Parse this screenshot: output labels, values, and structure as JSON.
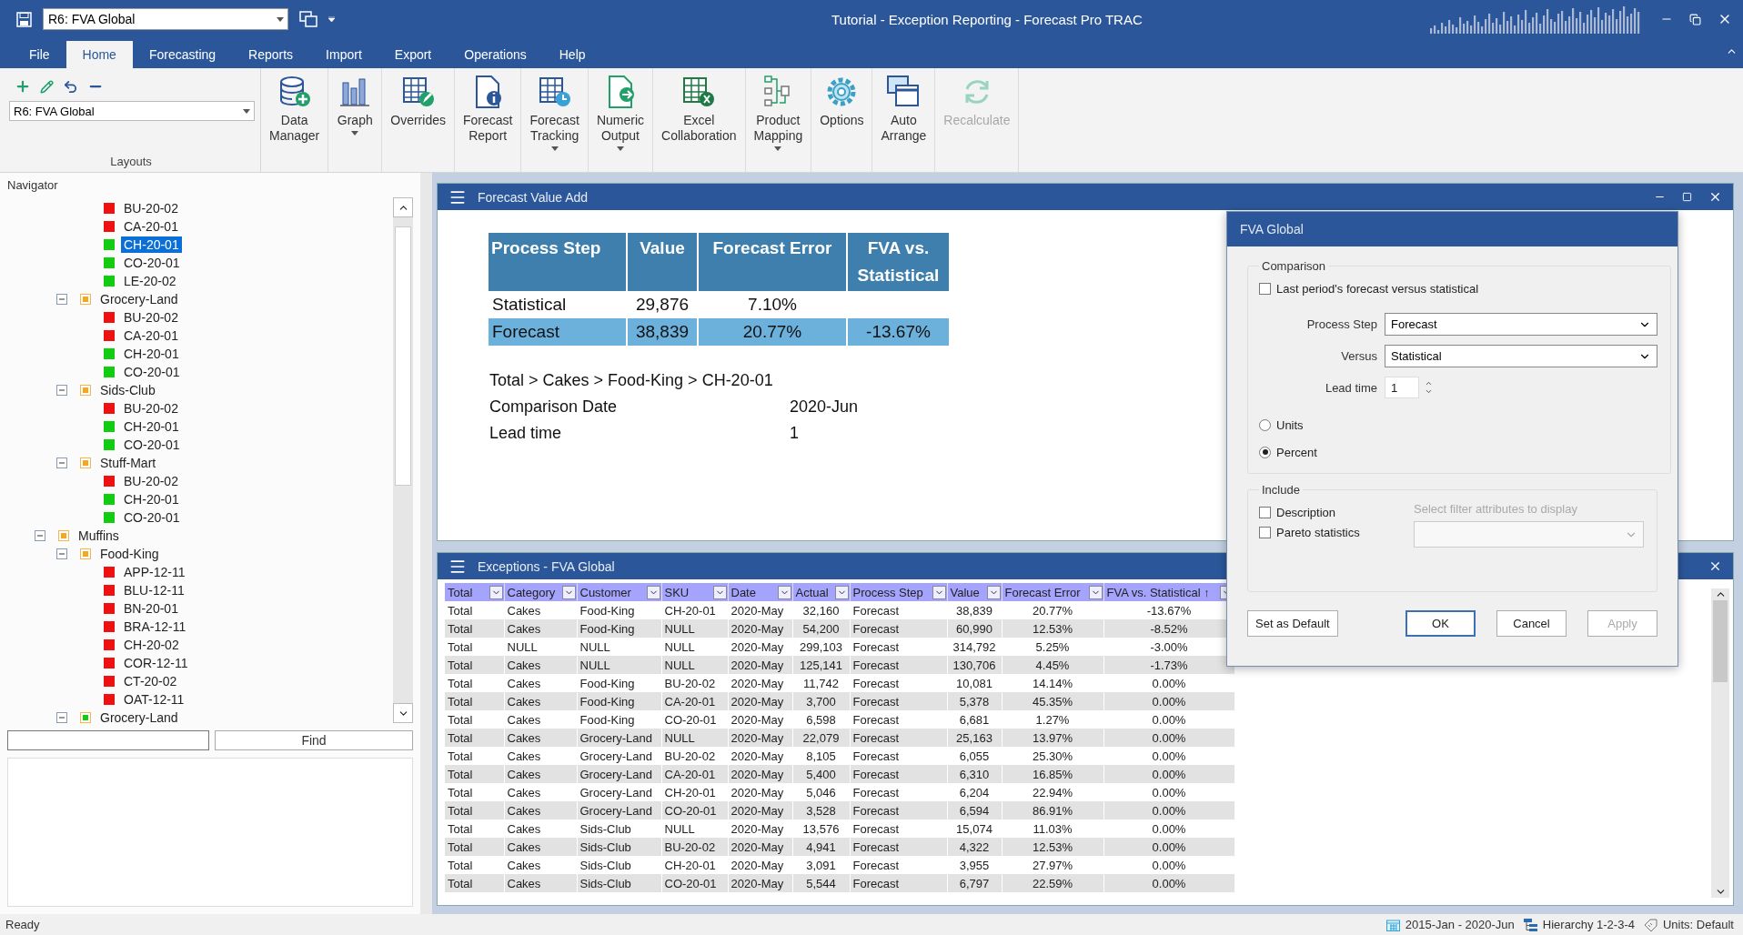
{
  "titlebar": {
    "layout": "R6: FVA Global",
    "title": "Tutorial - Exception Reporting - Forecast Pro TRAC"
  },
  "menu_tabs": [
    {
      "label": "File",
      "selected": false
    },
    {
      "label": "Home",
      "selected": true
    },
    {
      "label": "Forecasting",
      "selected": false
    },
    {
      "label": "Reports",
      "selected": false
    },
    {
      "label": "Import",
      "selected": false
    },
    {
      "label": "Export",
      "selected": false
    },
    {
      "label": "Operations",
      "selected": false
    },
    {
      "label": "Help",
      "selected": false
    }
  ],
  "ribbon": {
    "layouts": {
      "value": "R6: FVA Global",
      "group_label": "Layouts"
    },
    "buttons": [
      {
        "lines": [
          "Data",
          "Manager"
        ],
        "menu": false,
        "disabled": false
      },
      {
        "lines": [
          "Graph"
        ],
        "menu": true,
        "disabled": false
      },
      {
        "lines": [
          "Overrides"
        ],
        "menu": false,
        "disabled": false
      },
      {
        "lines": [
          "Forecast",
          "Report"
        ],
        "menu": false,
        "disabled": false
      },
      {
        "lines": [
          "Forecast",
          "Tracking"
        ],
        "menu": true,
        "disabled": false
      },
      {
        "lines": [
          "Numeric",
          "Output"
        ],
        "menu": true,
        "disabled": false
      },
      {
        "lines": [
          "Excel",
          "Collaboration"
        ],
        "menu": false,
        "disabled": false
      },
      {
        "lines": [
          "Product",
          "Mapping"
        ],
        "menu": true,
        "disabled": false
      },
      {
        "lines": [
          "Options"
        ],
        "menu": false,
        "disabled": false
      },
      {
        "lines": [
          "Auto",
          "Arrange"
        ],
        "menu": false,
        "disabled": false
      },
      {
        "lines": [
          "Recalculate"
        ],
        "menu": false,
        "disabled": true
      }
    ]
  },
  "navigator": {
    "title": "Navigator",
    "tree": [
      {
        "children": [
          {
            "children": [
              {
                "label": "BU-20-02",
                "color": "#ee1111",
                "selected": false
              },
              {
                "label": "CA-20-01",
                "color": "#ee1111",
                "selected": false
              },
              {
                "label": "CH-20-01",
                "color": "#11cc11",
                "selected": true
              },
              {
                "label": "CO-20-01",
                "color": "#11cc11",
                "selected": false
              },
              {
                "label": "LE-20-02",
                "color": "#11cc11",
                "selected": false
              }
            ]
          },
          {
            "label": "Grocery-Land",
            "color": "#f5a623",
            "expanded": true,
            "children": [
              {
                "label": "BU-20-02",
                "color": "#ee1111",
                "selected": false
              },
              {
                "label": "CA-20-01",
                "color": "#ee1111",
                "selected": false
              },
              {
                "label": "CH-20-01",
                "color": "#11cc11",
                "selected": false
              },
              {
                "label": "CO-20-01",
                "color": "#11cc11",
                "selected": false
              }
            ]
          },
          {
            "label": "Sids-Club",
            "color": "#f5a623",
            "expanded": true,
            "children": [
              {
                "label": "BU-20-02",
                "color": "#ee1111",
                "selected": false
              },
              {
                "label": "CH-20-01",
                "color": "#11cc11",
                "selected": false
              },
              {
                "label": "CO-20-01",
                "color": "#11cc11",
                "selected": false
              }
            ]
          },
          {
            "label": "Stuff-Mart",
            "color": "#f5a623",
            "expanded": true,
            "children": [
              {
                "label": "BU-20-02",
                "color": "#ee1111",
                "selected": false
              },
              {
                "label": "CH-20-01",
                "color": "#11cc11",
                "selected": false
              },
              {
                "label": "CO-20-01",
                "color": "#11cc11",
                "selected": false
              }
            ]
          }
        ]
      },
      {
        "label": "Muffins",
        "color": "#f5a623",
        "expanded": true,
        "children": [
          {
            "label": "Food-King",
            "color": "#f5a623",
            "expanded": true,
            "children": [
              {
                "label": "APP-12-11",
                "color": "#ee1111",
                "selected": false
              },
              {
                "label": "BLU-12-11",
                "color": "#ee1111",
                "selected": false
              },
              {
                "label": "BN-20-01",
                "color": "#ee1111",
                "selected": false
              },
              {
                "label": "BRA-12-11",
                "color": "#ee1111",
                "selected": false
              },
              {
                "label": "CH-20-02",
                "color": "#ee1111",
                "selected": false
              },
              {
                "label": "COR-12-11",
                "color": "#ee1111",
                "selected": false
              },
              {
                "label": "CT-20-02",
                "color": "#ee1111",
                "selected": false
              },
              {
                "label": "OAT-12-11",
                "color": "#ee1111",
                "selected": false
              }
            ]
          },
          {
            "label": "Grocery-Land",
            "color": "#11cc11",
            "expanded": true
          }
        ]
      }
    ],
    "find_button": "Find"
  },
  "fva_window": {
    "title": "Forecast Value Add",
    "table": {
      "columns": [
        "Process Step",
        "Value",
        "Forecast Error",
        "FVA vs. Statistical"
      ],
      "rows": [
        {
          "cells": [
            "Statistical",
            "29,876",
            "7.10%"
          ],
          "selected": false
        },
        {
          "cells": [
            "Forecast",
            "38,839",
            "20.77%",
            "-13.67%"
          ],
          "selected": true
        }
      ]
    },
    "path": "Total > Cakes > Food-King > CH-20-01",
    "info": [
      {
        "label": "Comparison Date",
        "value": "2020-Jun"
      },
      {
        "label": "Lead time",
        "value": "1"
      }
    ]
  },
  "exceptions_window": {
    "title": "Exceptions - FVA Global",
    "columns": [
      "Total",
      "Category",
      "Customer",
      "SKU",
      "Date",
      "Actual",
      "Process Step",
      "Value",
      "Forecast Error",
      "FVA vs. Statistical ↑"
    ],
    "rows": [
      [
        "Total",
        "Cakes",
        "Food-King",
        "CH-20-01",
        "2020-May",
        "32,160",
        "Forecast",
        "38,839",
        "20.77%",
        "-13.67%"
      ],
      [
        "Total",
        "Cakes",
        "Food-King",
        "NULL",
        "2020-May",
        "54,200",
        "Forecast",
        "60,990",
        "12.53%",
        "-8.52%"
      ],
      [
        "Total",
        "NULL",
        "NULL",
        "NULL",
        "2020-May",
        "299,103",
        "Forecast",
        "314,792",
        "5.25%",
        "-3.00%"
      ],
      [
        "Total",
        "Cakes",
        "NULL",
        "NULL",
        "2020-May",
        "125,141",
        "Forecast",
        "130,706",
        "4.45%",
        "-1.73%"
      ],
      [
        "Total",
        "Cakes",
        "Food-King",
        "BU-20-02",
        "2020-May",
        "11,742",
        "Forecast",
        "10,081",
        "14.14%",
        "0.00%"
      ],
      [
        "Total",
        "Cakes",
        "Food-King",
        "CA-20-01",
        "2020-May",
        "3,700",
        "Forecast",
        "5,378",
        "45.35%",
        "0.00%"
      ],
      [
        "Total",
        "Cakes",
        "Food-King",
        "CO-20-01",
        "2020-May",
        "6,598",
        "Forecast",
        "6,681",
        "1.27%",
        "0.00%"
      ],
      [
        "Total",
        "Cakes",
        "Grocery-Land",
        "NULL",
        "2020-May",
        "22,079",
        "Forecast",
        "25,163",
        "13.97%",
        "0.00%"
      ],
      [
        "Total",
        "Cakes",
        "Grocery-Land",
        "BU-20-02",
        "2020-May",
        "8,105",
        "Forecast",
        "6,055",
        "25.30%",
        "0.00%"
      ],
      [
        "Total",
        "Cakes",
        "Grocery-Land",
        "CA-20-01",
        "2020-May",
        "5,400",
        "Forecast",
        "6,310",
        "16.85%",
        "0.00%"
      ],
      [
        "Total",
        "Cakes",
        "Grocery-Land",
        "CH-20-01",
        "2020-May",
        "5,046",
        "Forecast",
        "6,204",
        "22.94%",
        "0.00%"
      ],
      [
        "Total",
        "Cakes",
        "Grocery-Land",
        "CO-20-01",
        "2020-May",
        "3,528",
        "Forecast",
        "6,594",
        "86.91%",
        "0.00%"
      ],
      [
        "Total",
        "Cakes",
        "Sids-Club",
        "NULL",
        "2020-May",
        "13,576",
        "Forecast",
        "15,074",
        "11.03%",
        "0.00%"
      ],
      [
        "Total",
        "Cakes",
        "Sids-Club",
        "BU-20-02",
        "2020-May",
        "4,941",
        "Forecast",
        "4,322",
        "12.53%",
        "0.00%"
      ],
      [
        "Total",
        "Cakes",
        "Sids-Club",
        "CH-20-01",
        "2020-May",
        "3,091",
        "Forecast",
        "3,955",
        "27.97%",
        "0.00%"
      ],
      [
        "Total",
        "Cakes",
        "Sids-Club",
        "CO-20-01",
        "2020-May",
        "5,544",
        "Forecast",
        "6,797",
        "22.59%",
        "0.00%"
      ]
    ]
  },
  "dialog": {
    "title": "FVA Global",
    "comparison": {
      "legend": "Comparison",
      "last_period": {
        "label": "Last period's forecast versus statistical",
        "checked": false
      },
      "process_step": {
        "label": "Process Step",
        "value": "Forecast"
      },
      "versus": {
        "label": "Versus",
        "value": "Statistical"
      },
      "lead_time": {
        "label": "Lead time",
        "value": "1"
      },
      "measures": [
        {
          "label": "Units",
          "selected": false
        },
        {
          "label": "Percent",
          "selected": true
        }
      ]
    },
    "include": {
      "legend": "Include",
      "options": [
        {
          "label": "Description",
          "checked": false
        },
        {
          "label": "Pareto statistics",
          "checked": false
        }
      ],
      "filter_hint": "Select filter attributes to display"
    },
    "buttons": [
      {
        "label": "Set as Default",
        "default": false,
        "disabled": false
      },
      {
        "label": "OK",
        "default": true,
        "disabled": false
      },
      {
        "label": "Cancel",
        "default": false,
        "disabled": false
      },
      {
        "label": "Apply",
        "default": false,
        "disabled": true
      }
    ]
  },
  "status_bar": {
    "message": "Ready",
    "items": [
      "2015-Jan - 2020-Jun",
      "Hierarchy 1-2-3-4",
      "Units: Default"
    ]
  }
}
